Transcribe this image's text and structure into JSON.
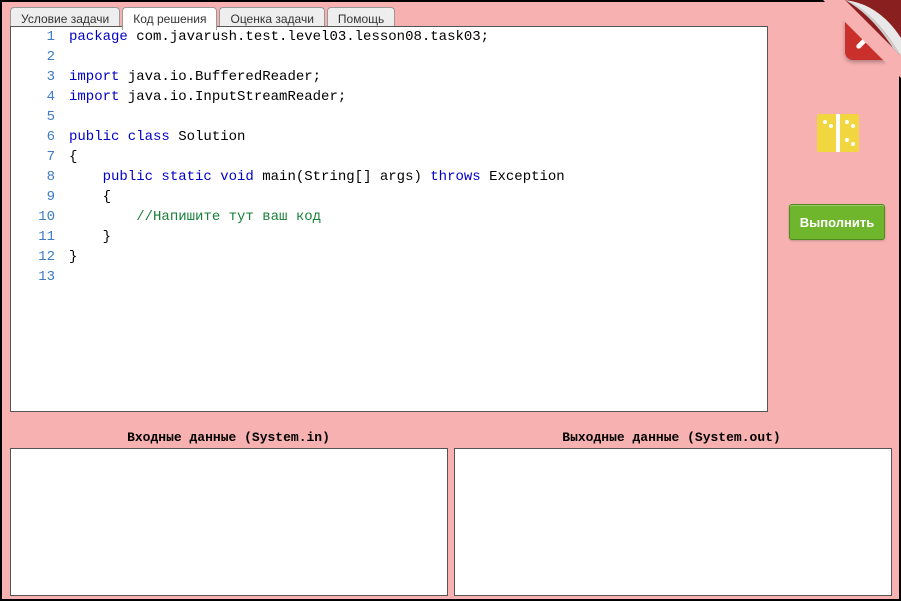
{
  "tabs": {
    "t0": "Условие задачи",
    "t1": "Код решения",
    "t2": "Оценка задачи",
    "t3": "Помощь",
    "active_index": 1
  },
  "code": {
    "lines": [
      {
        "n": "1",
        "tokens": [
          {
            "t": "package ",
            "c": "kw"
          },
          {
            "t": "com.javarush.test.level03.lesson08.task03;",
            "c": "pkg"
          }
        ]
      },
      {
        "n": "2",
        "tokens": []
      },
      {
        "n": "3",
        "tokens": [
          {
            "t": "import ",
            "c": "kw"
          },
          {
            "t": "java.io.BufferedReader;",
            "c": "pkg"
          }
        ]
      },
      {
        "n": "4",
        "tokens": [
          {
            "t": "import ",
            "c": "kw"
          },
          {
            "t": "java.io.InputStreamReader;",
            "c": "pkg"
          }
        ]
      },
      {
        "n": "5",
        "tokens": []
      },
      {
        "n": "6",
        "tokens": [
          {
            "t": "public class ",
            "c": "kw"
          },
          {
            "t": "Solution",
            "c": "type"
          }
        ]
      },
      {
        "n": "7",
        "tokens": [
          {
            "t": "{",
            "c": "pkg"
          }
        ]
      },
      {
        "n": "8",
        "tokens": [
          {
            "t": "    ",
            "c": "pkg"
          },
          {
            "t": "public static void ",
            "c": "kw"
          },
          {
            "t": "main(String[] args) ",
            "c": "pkg"
          },
          {
            "t": "throws ",
            "c": "kw"
          },
          {
            "t": "Exception",
            "c": "pkg"
          }
        ]
      },
      {
        "n": "9",
        "tokens": [
          {
            "t": "    {",
            "c": "pkg"
          }
        ]
      },
      {
        "n": "10",
        "tokens": [
          {
            "t": "        ",
            "c": "pkg"
          },
          {
            "t": "//Напишите тут ваш код",
            "c": "cm"
          }
        ]
      },
      {
        "n": "11",
        "tokens": [
          {
            "t": "    }",
            "c": "pkg"
          }
        ]
      },
      {
        "n": "12",
        "tokens": [
          {
            "t": "}",
            "c": "pkg"
          }
        ]
      },
      {
        "n": "13",
        "tokens": []
      }
    ]
  },
  "io": {
    "input_label": "Входные данные (System.in)",
    "output_label": "Выходные данные (System.out)",
    "input_value": "",
    "output_value": ""
  },
  "buttons": {
    "run": "Выполнить"
  }
}
